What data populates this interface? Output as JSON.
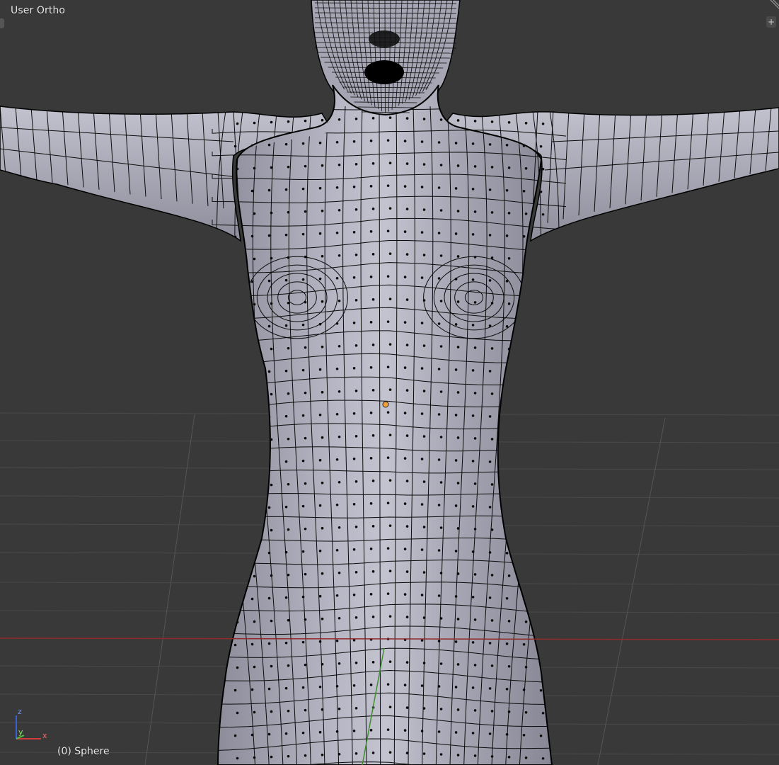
{
  "viewport": {
    "view_label": "User Ortho",
    "object_label": "(0) Sphere",
    "plus_symbol": "+",
    "axes": {
      "z": "z",
      "y": "y",
      "x": "x"
    }
  },
  "colors": {
    "background": "#393939",
    "grid_line": "#4a4a4a",
    "x_axis": "#8f2b2b",
    "y_axis": "#3f8f2f",
    "mesh_fill": "#a9a9b7",
    "wire": "#0b0b0b",
    "origin_dot": "#f5a13a",
    "text": "#e6e6e6"
  }
}
